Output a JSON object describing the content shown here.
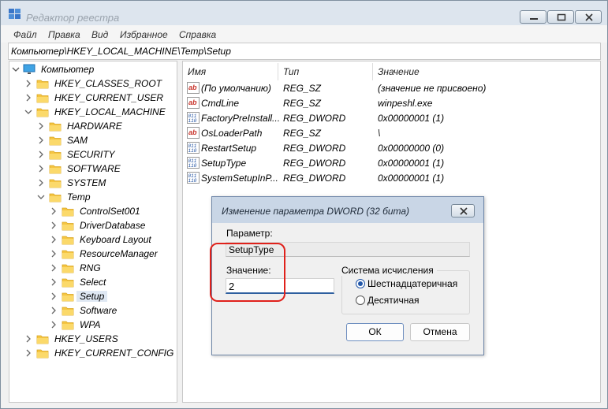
{
  "window": {
    "title": "Редактор реестра"
  },
  "menu": [
    "Файл",
    "Правка",
    "Вид",
    "Избранное",
    "Справка"
  ],
  "address": "Компьютер\\HKEY_LOCAL_MACHINE\\Temp\\Setup",
  "tree": {
    "root": "Компьютер",
    "items": [
      {
        "label": "HKEY_CLASSES_ROOT",
        "level": 1,
        "expanded": false
      },
      {
        "label": "HKEY_CURRENT_USER",
        "level": 1,
        "expanded": false
      },
      {
        "label": "HKEY_LOCAL_MACHINE",
        "level": 1,
        "expanded": true
      },
      {
        "label": "HARDWARE",
        "level": 2,
        "expanded": false
      },
      {
        "label": "SAM",
        "level": 2,
        "expanded": false
      },
      {
        "label": "SECURITY",
        "level": 2,
        "expanded": false
      },
      {
        "label": "SOFTWARE",
        "level": 2,
        "expanded": false
      },
      {
        "label": "SYSTEM",
        "level": 2,
        "expanded": false
      },
      {
        "label": "Temp",
        "level": 2,
        "expanded": true
      },
      {
        "label": "ControlSet001",
        "level": 3,
        "expanded": false
      },
      {
        "label": "DriverDatabase",
        "level": 3,
        "expanded": false
      },
      {
        "label": "Keyboard Layout",
        "level": 3,
        "expanded": false
      },
      {
        "label": "ResourceManager",
        "level": 3,
        "expanded": false
      },
      {
        "label": "RNG",
        "level": 3,
        "expanded": false
      },
      {
        "label": "Select",
        "level": 3,
        "expanded": false
      },
      {
        "label": "Setup",
        "level": 3,
        "expanded": false,
        "selected": true
      },
      {
        "label": "Software",
        "level": 3,
        "expanded": false
      },
      {
        "label": "WPA",
        "level": 3,
        "expanded": false
      },
      {
        "label": "HKEY_USERS",
        "level": 1,
        "expanded": false
      },
      {
        "label": "HKEY_CURRENT_CONFIG",
        "level": 1,
        "expanded": false
      }
    ]
  },
  "list": {
    "headers": {
      "name": "Имя",
      "type": "Тип",
      "value": "Значение"
    },
    "rows": [
      {
        "name": "(По умолчанию)",
        "type": "REG_SZ",
        "value": "(значение не присвоено)",
        "icon": "string-value-icon"
      },
      {
        "name": "CmdLine",
        "type": "REG_SZ",
        "value": "winpeshl.exe",
        "icon": "string-value-icon"
      },
      {
        "name": "FactoryPreInstall...",
        "type": "REG_DWORD",
        "value": "0x00000001 (1)",
        "icon": "binary-value-icon"
      },
      {
        "name": "OsLoaderPath",
        "type": "REG_SZ",
        "value": "\\",
        "icon": "string-value-icon"
      },
      {
        "name": "RestartSetup",
        "type": "REG_DWORD",
        "value": "0x00000000 (0)",
        "icon": "binary-value-icon"
      },
      {
        "name": "SetupType",
        "type": "REG_DWORD",
        "value": "0x00000001 (1)",
        "icon": "binary-value-icon"
      },
      {
        "name": "SystemSetupInP...",
        "type": "REG_DWORD",
        "value": "0x00000001 (1)",
        "icon": "binary-value-icon"
      }
    ]
  },
  "dialog": {
    "title": "Изменение параметра DWORD (32 бита)",
    "param_label": "Параметр:",
    "param_value": "SetupType",
    "value_label": "Значение:",
    "value": "2",
    "base_label": "Система исчисления",
    "radio_hex": "Шестнадцатеричная",
    "radio_dec": "Десятичная",
    "selected_base": "hex",
    "ok": "ОК",
    "cancel": "Отмена"
  },
  "colors": {
    "highlight": "#e0211b",
    "accent": "#2156a8",
    "folder": "#f5c542"
  }
}
